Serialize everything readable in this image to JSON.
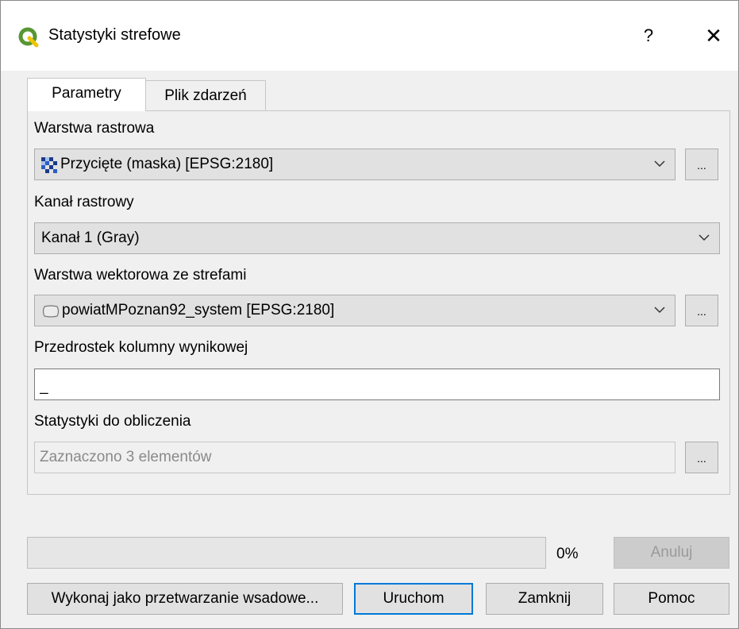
{
  "window": {
    "title": "Statystyki strefowe",
    "help_label": "?",
    "close_label": "✕",
    "app_icon": "qgis-logo-icon"
  },
  "tabs": [
    {
      "label": "Parametry",
      "active": true
    },
    {
      "label": "Plik zdarzeń",
      "active": false
    }
  ],
  "params": {
    "raster_layer_label": "Warstwa rastrowa",
    "raster_layer_value": "Przycięte (maska) [EPSG:2180]",
    "raster_layer_icon": "raster-layer-icon",
    "band_label": "Kanał rastrowy",
    "band_value": "Kanał 1 (Gray)",
    "vector_layer_label": "Warstwa wektorowa ze strefami",
    "vector_layer_value": "powiatMPoznan92_system [EPSG:2180]",
    "vector_layer_icon": "polygon-layer-icon",
    "prefix_label": "Przedrostek kolumny wynikowej",
    "prefix_value": "_",
    "stats_label": "Statystyki do obliczenia",
    "stats_value": "Zaznaczono 3 elementów",
    "browse_label": "..."
  },
  "footer": {
    "progress_percent": 0,
    "progress_text": "0%",
    "cancel_label": "Anuluj",
    "batch_label": "Wykonaj jako przetwarzanie wsadowe...",
    "run_label": "Uruchom",
    "close_label": "Zamknij",
    "help_label": "Pomoc"
  },
  "colors": {
    "progress_fill": "#06b025",
    "default_button_border": "#0078d7",
    "qgis_green": "#589632",
    "qgis_yellow": "#f0c400"
  }
}
